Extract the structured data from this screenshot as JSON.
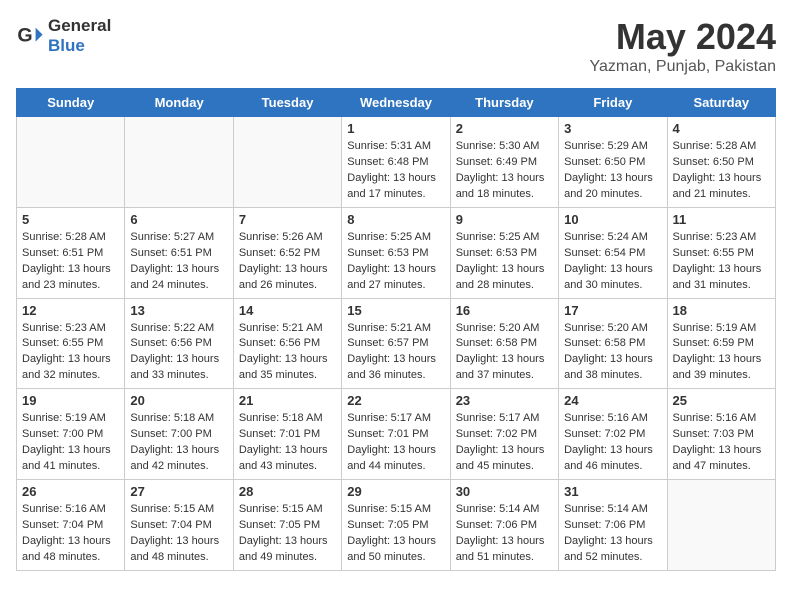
{
  "logo": {
    "text_general": "General",
    "text_blue": "Blue",
    "icon": "▶"
  },
  "title": "May 2024",
  "subtitle": "Yazman, Punjab, Pakistan",
  "days_of_week": [
    "Sunday",
    "Monday",
    "Tuesday",
    "Wednesday",
    "Thursday",
    "Friday",
    "Saturday"
  ],
  "weeks": [
    [
      {
        "date": "",
        "info": ""
      },
      {
        "date": "",
        "info": ""
      },
      {
        "date": "",
        "info": ""
      },
      {
        "date": "1",
        "info": "Sunrise: 5:31 AM\nSunset: 6:48 PM\nDaylight: 13 hours and 17 minutes."
      },
      {
        "date": "2",
        "info": "Sunrise: 5:30 AM\nSunset: 6:49 PM\nDaylight: 13 hours and 18 minutes."
      },
      {
        "date": "3",
        "info": "Sunrise: 5:29 AM\nSunset: 6:50 PM\nDaylight: 13 hours and 20 minutes."
      },
      {
        "date": "4",
        "info": "Sunrise: 5:28 AM\nSunset: 6:50 PM\nDaylight: 13 hours and 21 minutes."
      }
    ],
    [
      {
        "date": "5",
        "info": "Sunrise: 5:28 AM\nSunset: 6:51 PM\nDaylight: 13 hours and 23 minutes."
      },
      {
        "date": "6",
        "info": "Sunrise: 5:27 AM\nSunset: 6:51 PM\nDaylight: 13 hours and 24 minutes."
      },
      {
        "date": "7",
        "info": "Sunrise: 5:26 AM\nSunset: 6:52 PM\nDaylight: 13 hours and 26 minutes."
      },
      {
        "date": "8",
        "info": "Sunrise: 5:25 AM\nSunset: 6:53 PM\nDaylight: 13 hours and 27 minutes."
      },
      {
        "date": "9",
        "info": "Sunrise: 5:25 AM\nSunset: 6:53 PM\nDaylight: 13 hours and 28 minutes."
      },
      {
        "date": "10",
        "info": "Sunrise: 5:24 AM\nSunset: 6:54 PM\nDaylight: 13 hours and 30 minutes."
      },
      {
        "date": "11",
        "info": "Sunrise: 5:23 AM\nSunset: 6:55 PM\nDaylight: 13 hours and 31 minutes."
      }
    ],
    [
      {
        "date": "12",
        "info": "Sunrise: 5:23 AM\nSunset: 6:55 PM\nDaylight: 13 hours and 32 minutes."
      },
      {
        "date": "13",
        "info": "Sunrise: 5:22 AM\nSunset: 6:56 PM\nDaylight: 13 hours and 33 minutes."
      },
      {
        "date": "14",
        "info": "Sunrise: 5:21 AM\nSunset: 6:56 PM\nDaylight: 13 hours and 35 minutes."
      },
      {
        "date": "15",
        "info": "Sunrise: 5:21 AM\nSunset: 6:57 PM\nDaylight: 13 hours and 36 minutes."
      },
      {
        "date": "16",
        "info": "Sunrise: 5:20 AM\nSunset: 6:58 PM\nDaylight: 13 hours and 37 minutes."
      },
      {
        "date": "17",
        "info": "Sunrise: 5:20 AM\nSunset: 6:58 PM\nDaylight: 13 hours and 38 minutes."
      },
      {
        "date": "18",
        "info": "Sunrise: 5:19 AM\nSunset: 6:59 PM\nDaylight: 13 hours and 39 minutes."
      }
    ],
    [
      {
        "date": "19",
        "info": "Sunrise: 5:19 AM\nSunset: 7:00 PM\nDaylight: 13 hours and 41 minutes."
      },
      {
        "date": "20",
        "info": "Sunrise: 5:18 AM\nSunset: 7:00 PM\nDaylight: 13 hours and 42 minutes."
      },
      {
        "date": "21",
        "info": "Sunrise: 5:18 AM\nSunset: 7:01 PM\nDaylight: 13 hours and 43 minutes."
      },
      {
        "date": "22",
        "info": "Sunrise: 5:17 AM\nSunset: 7:01 PM\nDaylight: 13 hours and 44 minutes."
      },
      {
        "date": "23",
        "info": "Sunrise: 5:17 AM\nSunset: 7:02 PM\nDaylight: 13 hours and 45 minutes."
      },
      {
        "date": "24",
        "info": "Sunrise: 5:16 AM\nSunset: 7:02 PM\nDaylight: 13 hours and 46 minutes."
      },
      {
        "date": "25",
        "info": "Sunrise: 5:16 AM\nSunset: 7:03 PM\nDaylight: 13 hours and 47 minutes."
      }
    ],
    [
      {
        "date": "26",
        "info": "Sunrise: 5:16 AM\nSunset: 7:04 PM\nDaylight: 13 hours and 48 minutes."
      },
      {
        "date": "27",
        "info": "Sunrise: 5:15 AM\nSunset: 7:04 PM\nDaylight: 13 hours and 48 minutes."
      },
      {
        "date": "28",
        "info": "Sunrise: 5:15 AM\nSunset: 7:05 PM\nDaylight: 13 hours and 49 minutes."
      },
      {
        "date": "29",
        "info": "Sunrise: 5:15 AM\nSunset: 7:05 PM\nDaylight: 13 hours and 50 minutes."
      },
      {
        "date": "30",
        "info": "Sunrise: 5:14 AM\nSunset: 7:06 PM\nDaylight: 13 hours and 51 minutes."
      },
      {
        "date": "31",
        "info": "Sunrise: 5:14 AM\nSunset: 7:06 PM\nDaylight: 13 hours and 52 minutes."
      },
      {
        "date": "",
        "info": ""
      }
    ]
  ]
}
